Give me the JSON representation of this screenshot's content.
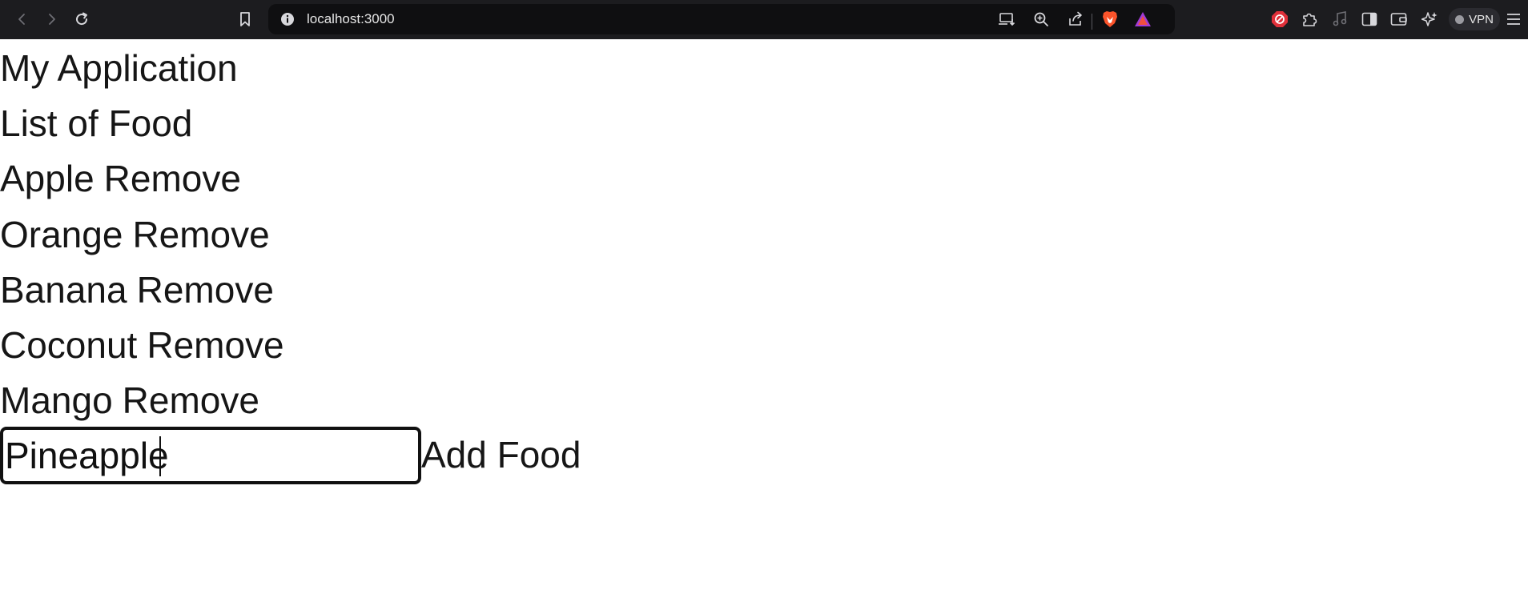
{
  "browser": {
    "url": "localhost:3000",
    "vpn_label": "VPN"
  },
  "app": {
    "title": "My Application",
    "list_heading": "List of Food",
    "remove_label": "Remove",
    "foods": [
      {
        "name": "Apple"
      },
      {
        "name": "Orange"
      },
      {
        "name": "Banana"
      },
      {
        "name": "Coconut"
      },
      {
        "name": "Mango"
      }
    ],
    "input_value": "Pineapple",
    "add_label": "Add Food"
  },
  "colors": {
    "toolbar_bg": "#1c1c1f",
    "urlbar_bg": "#0f0f11",
    "brave_orange": "#fb542b",
    "shield_red": "#e0303a",
    "page_bg": "#ffffff",
    "text": "#161616"
  },
  "icons": [
    "back-icon",
    "forward-icon",
    "reload-icon",
    "bookmark-icon",
    "site-info-icon",
    "install-app-icon",
    "zoom-icon",
    "share-icon",
    "brave-shields-icon",
    "brave-rewards-icon",
    "adblock-icon",
    "extensions-icon",
    "media-icon",
    "sidebar-icon",
    "wallet-icon",
    "leo-ai-icon",
    "menu-icon"
  ]
}
